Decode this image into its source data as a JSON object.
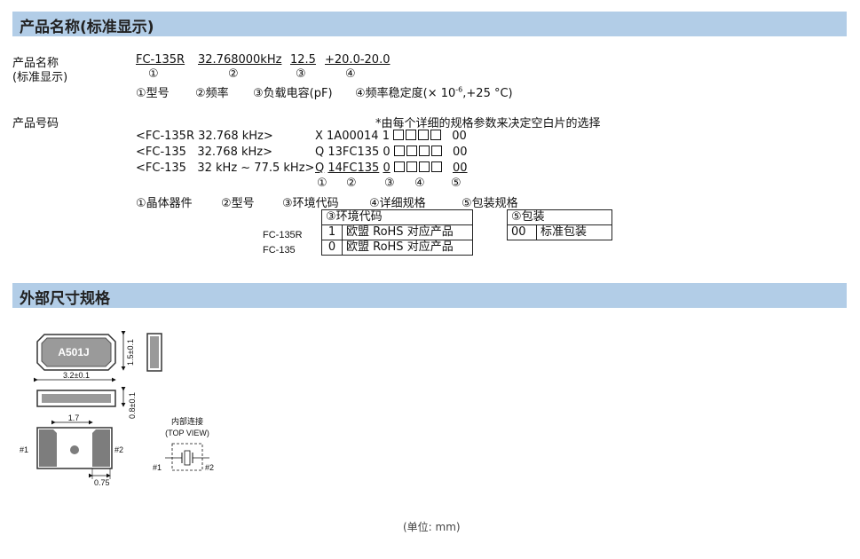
{
  "sections": {
    "name_title": "产品名称(标准显示)",
    "dims_title": "外部尺寸规格"
  },
  "name_block": {
    "label1": "产品名称",
    "label2": "(标准显示)",
    "part1": "FC-135R",
    "part2": "32.768000kHz",
    "part3": "12.5",
    "part4": "+20.0-20.0",
    "m1": "①",
    "m2": "②",
    "m3": "③",
    "m4": "④",
    "legend1": "①型号",
    "legend2": "②频率",
    "legend3": "③负载电容(pF)",
    "legend4": "④频率稳定度(× 10",
    "legend4_sup": "-6",
    "legend4_end": ",+25 °C)"
  },
  "code_block": {
    "label": "产品号码",
    "note": "*由每个详细的规格参数来决定空白片的选择",
    "rows": [
      {
        "left": "<FC-135R 32.768 kHz>",
        "prefix": "X 1A00014 1",
        "suffix": "00"
      },
      {
        "left": "<FC-135   32.768 kHz>",
        "prefix": "Q 13FC135 0",
        "suffix": "00"
      },
      {
        "left": "<FC-135   32 kHz ~ 77.5 kHz>",
        "prefix_a": "Q",
        "prefix_b": "14FC135",
        "prefix_c": "0",
        "suffix": "00"
      }
    ],
    "markers": [
      "①",
      "②",
      "③",
      "④",
      "⑤"
    ],
    "legend": [
      "①晶体器件",
      "②型号",
      "③环境代码",
      "④详细规格",
      "⑤包装规格"
    ],
    "env_table": {
      "header": "③环境代码",
      "labels": [
        "FC-135R",
        "FC-135"
      ],
      "rows": [
        [
          "1",
          "欧盟 RoHS 对应产品"
        ],
        [
          "0",
          "欧盟 RoHS 对应产品"
        ]
      ]
    },
    "pack_table": {
      "header": "⑤包装",
      "rows": [
        [
          "00",
          "标准包装"
        ]
      ]
    }
  },
  "drawing": {
    "marking": "A501J",
    "dim_width": "3.2±0.1",
    "dim_height": "1.5±0.1",
    "dim_thickness": "0.8±0.1",
    "dim_pitch": "1.7",
    "dim_pad": "0.75",
    "pin1": "#1",
    "pin2": "#2",
    "internal_label": "内部连接",
    "top_view": "(TOP VIEW)",
    "unit": "(单位: mm)"
  },
  "colors": {
    "section_bar": "#b2cde7",
    "package_gray": "#9a9a9a",
    "pad_gray": "#7d7d7d"
  }
}
